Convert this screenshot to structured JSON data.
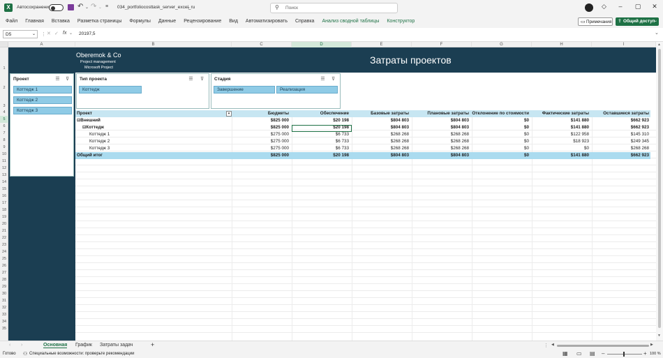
{
  "titlebar": {
    "autosave_label": "Автосохранение",
    "filename": "034_portfoliocosttask_server_excel_ru",
    "search_placeholder": "Поиск"
  },
  "menu": [
    "Файл",
    "Главная",
    "Вставка",
    "Разметка страницы",
    "Формулы",
    "Данные",
    "Рецензирование",
    "Вид",
    "Автоматизировать",
    "Справка",
    "Анализ сводной таблицы",
    "Конструктор"
  ],
  "ribbon_buttons": {
    "comments": "Примечания",
    "share": "Общий доступ"
  },
  "formula": {
    "cell_ref": "D5",
    "fx": "fx",
    "value": "20197,5"
  },
  "columns": [
    "A",
    "B",
    "C",
    "D",
    "E",
    "F",
    "G",
    "H",
    "I"
  ],
  "rows": [
    "1",
    "2",
    "3",
    "4",
    "5",
    "6",
    "7",
    "8",
    "9",
    "10",
    "11",
    "12",
    "13",
    "14",
    "15",
    "16",
    "17",
    "18",
    "19",
    "20",
    "21",
    "22",
    "23",
    "24",
    "25",
    "26",
    "27",
    "28",
    "29",
    "30",
    "31",
    "32",
    "33",
    "34",
    "35"
  ],
  "banner": {
    "company": "Oberemok & Co",
    "line1": "Project management",
    "line2": "Microsoft Project",
    "title": "Затраты проектов"
  },
  "slicers": {
    "project": {
      "title": "Проект",
      "items": [
        "Коттедж 1",
        "Коттедж 2",
        "Коттедж 3"
      ]
    },
    "type": {
      "title": "Тип проекта",
      "items": [
        "Коттедж"
      ]
    },
    "stage": {
      "title": "Стадия",
      "items": [
        "Завершение",
        "Реализация"
      ]
    }
  },
  "pivot": {
    "headers": [
      "Проект",
      "Бюджеты",
      "Обеспечение",
      "Базовые затраты",
      "Плановые затраты",
      "Отклонение по стоимости",
      "Фактические затраты",
      "Оставшиеся затраты"
    ],
    "rows": [
      {
        "label": "⊟Внешний",
        "vals": [
          "$825 000",
          "$20 198",
          "$804 803",
          "$804 803",
          "$0",
          "$141 880",
          "$662 923"
        ]
      },
      {
        "label": "⊟Коттедж",
        "vals": [
          "$825 000",
          "$20 198",
          "$804 803",
          "$804 803",
          "$0",
          "$141 880",
          "$662 923"
        ]
      },
      {
        "label": "Коттедж 1",
        "vals": [
          "$275 000",
          "$6 733",
          "$268 268",
          "$268 268",
          "$0",
          "$122 958",
          "$145 310"
        ]
      },
      {
        "label": "Коттедж 2",
        "vals": [
          "$275 000",
          "$6 733",
          "$268 268",
          "$268 268",
          "$0",
          "$18 923",
          "$249 345"
        ]
      },
      {
        "label": "Коттедж 3",
        "vals": [
          "$275 000",
          "$6 733",
          "$268 268",
          "$268 268",
          "$0",
          "$0",
          "$268 268"
        ]
      }
    ],
    "total": {
      "label": "Общий итог",
      "vals": [
        "$825 000",
        "$20 198",
        "$804 803",
        "$804 803",
        "$0",
        "$141 880",
        "$662 923"
      ]
    }
  },
  "sheets": [
    "Основная",
    "График",
    "Затраты задач"
  ],
  "status": {
    "ready": "Готово",
    "accessibility": "Специальные возможности: проверьте рекомендации",
    "zoom": "100 %"
  }
}
